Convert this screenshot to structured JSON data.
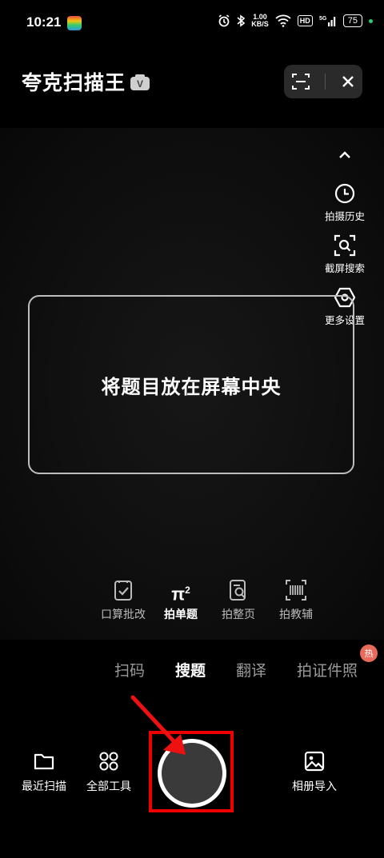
{
  "status_bar": {
    "time": "10:21",
    "speed_value": "1.00",
    "speed_unit": "KB/S",
    "hd": "HD",
    "network": "5G",
    "battery": "75"
  },
  "header": {
    "title": "夸克扫描王",
    "vip_badge": "V"
  },
  "side_tools": [
    {
      "label": "拍摄历史",
      "icon": "clock-icon"
    },
    {
      "label": "截屏搜索",
      "icon": "screenshot-search-icon"
    },
    {
      "label": "更多设置",
      "icon": "settings-hex-icon"
    }
  ],
  "scan_frame": {
    "hint": "将题目放在屏幕中央"
  },
  "sub_modes": [
    {
      "label": "口算批改",
      "icon": "check-doc-icon"
    },
    {
      "label": "拍单题",
      "icon": "pi-squared-icon",
      "glyph": "π",
      "sup": "2"
    },
    {
      "label": "拍整页",
      "icon": "page-search-icon"
    },
    {
      "label": "拍教辅",
      "icon": "barcode-icon"
    }
  ],
  "tabs": [
    {
      "label": "扫码"
    },
    {
      "label": "搜题"
    },
    {
      "label": "翻译"
    },
    {
      "label": "拍证件照"
    }
  ],
  "hot_badge": "热",
  "bottom": {
    "recent_scan": "最近扫描",
    "all_tools": "全部工具",
    "album_import": "相册导入"
  },
  "colors": {
    "background": "#000000",
    "highlight_box": "#ee0000",
    "hot_badge": "#e86a5a"
  }
}
